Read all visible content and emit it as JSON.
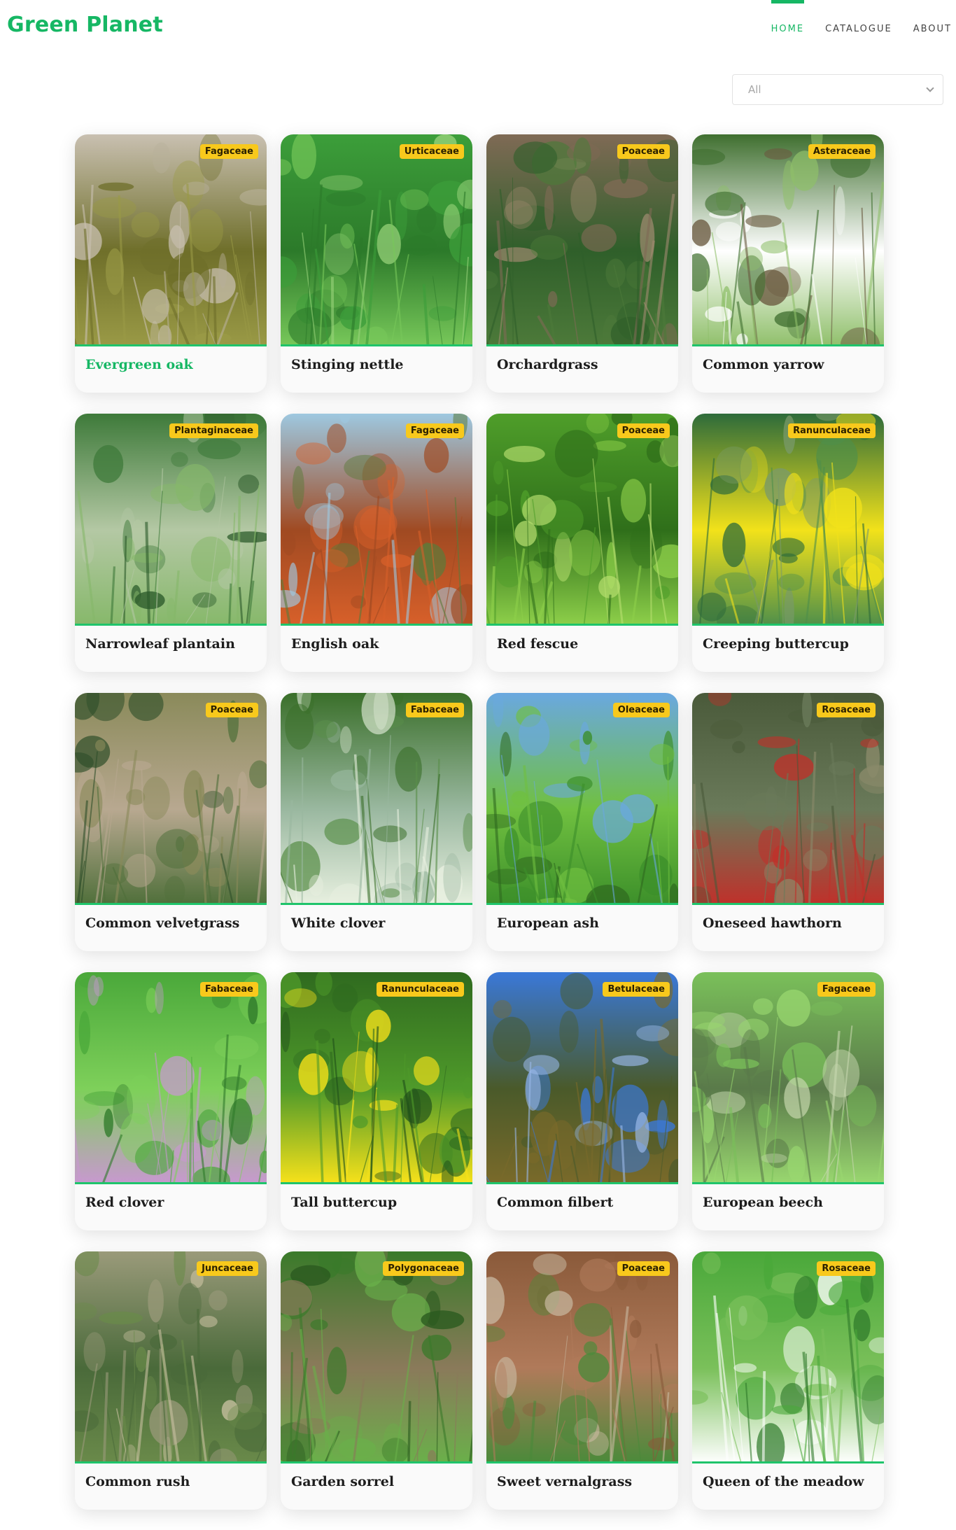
{
  "brand": "Green Planet",
  "nav": [
    {
      "label": "HOME",
      "active": true
    },
    {
      "label": "CATALOGUE",
      "active": false
    },
    {
      "label": "ABOUT",
      "active": false
    }
  ],
  "filter": {
    "selected": "All"
  },
  "plants": [
    {
      "name": "Evergreen oak",
      "family": "Fagaceae",
      "highlight": true,
      "palette": [
        "#c9c0b1",
        "#9a9a46",
        "#6f6f2a",
        "#b8b09a"
      ]
    },
    {
      "name": "Stinging nettle",
      "family": "Urticaceae",
      "palette": [
        "#3c9e3a",
        "#78c85a",
        "#2c7a2a",
        "#9ad47c"
      ]
    },
    {
      "name": "Orchardgrass",
      "family": "Poaceae",
      "palette": [
        "#7f6a55",
        "#4d7a3a",
        "#2f5f2a",
        "#a08a70"
      ]
    },
    {
      "name": "Common yarrow",
      "family": "Asteraceae",
      "palette": [
        "#3f6f2f",
        "#8fbf6a",
        "#ffffff",
        "#6a5a40"
      ]
    },
    {
      "name": "Narrowleaf plantain",
      "family": "Plantaginaceae",
      "palette": [
        "#3e7a3a",
        "#86b86a",
        "#b4c8a4",
        "#2b5a2a"
      ]
    },
    {
      "name": "English oak",
      "family": "Fagaceae",
      "palette": [
        "#9ec8e0",
        "#d8602a",
        "#a04a22",
        "#5b7a3a"
      ]
    },
    {
      "name": "Red fescue",
      "family": "Poaceae",
      "palette": [
        "#4f9e2a",
        "#8ed04a",
        "#2f6f1a",
        "#b8e070"
      ]
    },
    {
      "name": "Creeping buttercup",
      "family": "Ranunculaceae",
      "palette": [
        "#2e6b3a",
        "#4f8f4a",
        "#f2e21a",
        "#7a9a6a"
      ]
    },
    {
      "name": "Common velvetgrass",
      "family": "Poaceae",
      "palette": [
        "#8a8a5a",
        "#4f6f3a",
        "#b8a890",
        "#2f4f2a"
      ]
    },
    {
      "name": "White clover",
      "family": "Fabaceae",
      "palette": [
        "#3a6f2a",
        "#e8f0e0",
        "#9ab8a0",
        "#5a8f4a"
      ]
    },
    {
      "name": "European ash",
      "family": "Oleaceae",
      "palette": [
        "#6aa8e0",
        "#3c8f2a",
        "#70c040",
        "#2f6a1f"
      ]
    },
    {
      "name": "Oneseed hawthorn",
      "family": "Rosaceae",
      "palette": [
        "#4a5a3a",
        "#c0302a",
        "#6a7a5a",
        "#8a8a6a"
      ]
    },
    {
      "name": "Red clover",
      "family": "Fabaceae",
      "palette": [
        "#4aa83a",
        "#c898d0",
        "#7ed05a",
        "#2f7a2a"
      ]
    },
    {
      "name": "Tall buttercup",
      "family": "Ranunculaceae",
      "palette": [
        "#2f6a1f",
        "#f8e21a",
        "#4f9a2a",
        "#1f4f1a"
      ]
    },
    {
      "name": "Common filbert",
      "family": "Betulaceae",
      "palette": [
        "#3a78d8",
        "#7a6a2a",
        "#4a5a2a",
        "#9ab8e8"
      ]
    },
    {
      "name": "European beech",
      "family": "Fagaceae",
      "palette": [
        "#7ac05a",
        "#9ad870",
        "#5a7a4a",
        "#c8d8b0"
      ]
    },
    {
      "name": "Common rush",
      "family": "Juncaceae",
      "palette": [
        "#9a9a7a",
        "#6a8a4a",
        "#4a6a3a",
        "#c8c0a0"
      ]
    },
    {
      "name": "Garden sorrel",
      "family": "Polygonaceae",
      "palette": [
        "#3a7a2a",
        "#6ab04a",
        "#8a7a5a",
        "#2a5a1f"
      ]
    },
    {
      "name": "Sweet vernalgrass",
      "family": "Poaceae",
      "palette": [
        "#8a5a3a",
        "#4a8a3a",
        "#b07a5a",
        "#c8b8a0"
      ]
    },
    {
      "name": "Queen of the meadow",
      "family": "Rosaceae",
      "palette": [
        "#4aa83a",
        "#ffffff",
        "#7ac05a",
        "#2f7a2a"
      ]
    }
  ]
}
